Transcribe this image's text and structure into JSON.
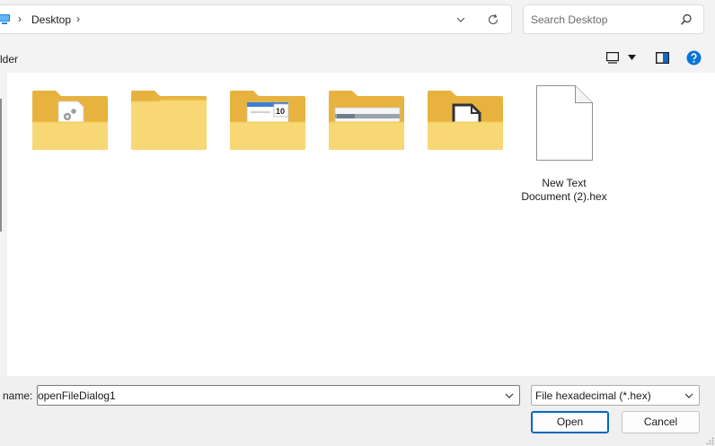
{
  "address_bar": {
    "location_icon": "this-pc-icon",
    "breadcrumb": "Desktop",
    "separator_glyph": "›",
    "dropdown_icon": "chevron-down-icon",
    "refresh_icon": "refresh-icon"
  },
  "search": {
    "placeholder": "Search Desktop",
    "icon": "search-icon"
  },
  "command_bar": {
    "new_folder_label": "lder",
    "view_icon": "view-layout-icon",
    "preview_icon": "preview-pane-icon",
    "help_icon": "help-icon"
  },
  "files": [
    {
      "name": "",
      "type": "folder",
      "icon": "folder-settings-icon"
    },
    {
      "name": "",
      "type": "folder",
      "icon": "folder-icon"
    },
    {
      "name": "",
      "type": "folder",
      "icon": "folder-calendar-icon",
      "badge": "10"
    },
    {
      "name": "",
      "type": "folder",
      "icon": "folder-window-icon"
    },
    {
      "name": "",
      "type": "folder",
      "icon": "folder-document-icon"
    },
    {
      "name": "New Text Document (2).hex",
      "type": "file",
      "icon": "blank-file-icon"
    }
  ],
  "footer": {
    "filename_label": "name:",
    "filename_value": "openFileDialog1",
    "filetype_value": "File hexadecimal (*.hex)",
    "open_label": "Open",
    "cancel_label": "Cancel"
  },
  "colors": {
    "accent": "#0067c0",
    "folder_back": "#e7b33e",
    "folder_front": "#f8d775",
    "window_bg": "#f3f3f3"
  }
}
